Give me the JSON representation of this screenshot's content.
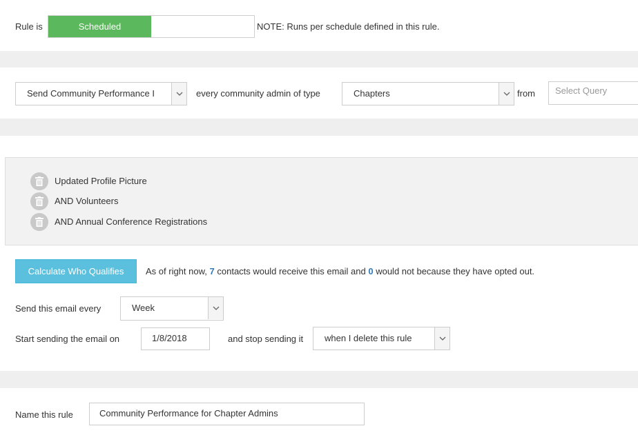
{
  "status": {
    "rule_is_label": "Rule is",
    "toggle_on_label": "Scheduled",
    "note": "NOTE: Runs per schedule defined in this rule.",
    "toggle_color": "#5cb85c"
  },
  "recipients": {
    "action_select": "Send Community Performance I",
    "every_admin_label": "every community admin of type",
    "type_select": "Chapters",
    "from_label": "from",
    "query_placeholder": "Select Query"
  },
  "criteria": {
    "items": [
      {
        "label": "Updated Profile Picture",
        "icon": "trash-icon"
      },
      {
        "label": "AND Volunteers",
        "icon": "trash-icon"
      },
      {
        "label": "AND Annual Conference Registrations",
        "icon": "trash-icon"
      }
    ]
  },
  "qualify": {
    "button_label": "Calculate Who Qualifies",
    "text_before": "As of right now,",
    "receive_count": "7",
    "text_middle": "contacts would receive this email and",
    "optout_count": "0",
    "text_after": "would not because they have opted out.",
    "button_color": "#5bc0de"
  },
  "schedule": {
    "frequency_label": "Send this email every",
    "frequency_value": "Week",
    "start_label": "Start sending the email on",
    "start_date": "1/8/2018",
    "stop_label": "and stop sending it",
    "stop_value": "when I delete this rule"
  },
  "naming": {
    "label": "Name this rule",
    "value": "Community Performance for Chapter Admins"
  }
}
